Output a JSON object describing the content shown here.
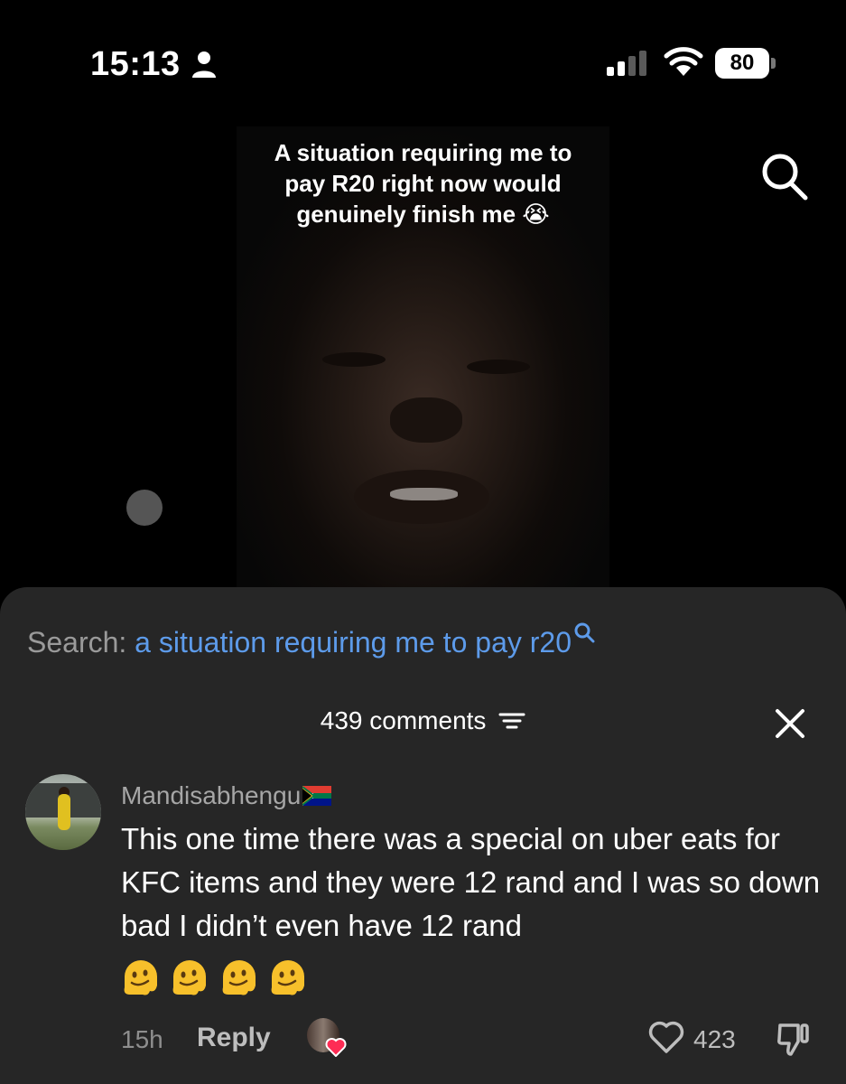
{
  "status_bar": {
    "time": "15:13",
    "battery": "80",
    "icons": [
      "person-icon",
      "signal-icon",
      "wifi-icon",
      "battery-icon"
    ]
  },
  "video": {
    "caption_line1": "A situation requiring me to",
    "caption_line2": "pay R20 right now would",
    "caption_line3": "genuinely finish me 😭"
  },
  "search": {
    "prefix": "Search:",
    "query": "a situation requiring me to pay r20"
  },
  "comments": {
    "count_label": "439 comments",
    "items": [
      {
        "username": "Mandisabhengu",
        "text": "This one time there was a special on uber eats for KFC items and they were 12 rand and I was so down bad I didn’t even have 12 rand",
        "emojis": [
          "melting-face",
          "melting-face",
          "melting-face",
          "melting-face"
        ],
        "time_ago": "15h",
        "reply_label": "Reply",
        "likes": "423"
      }
    ]
  },
  "colors": {
    "background": "#000000",
    "sheet": "#262626",
    "link": "#5d9bea",
    "muted": "#9a9a9a"
  }
}
